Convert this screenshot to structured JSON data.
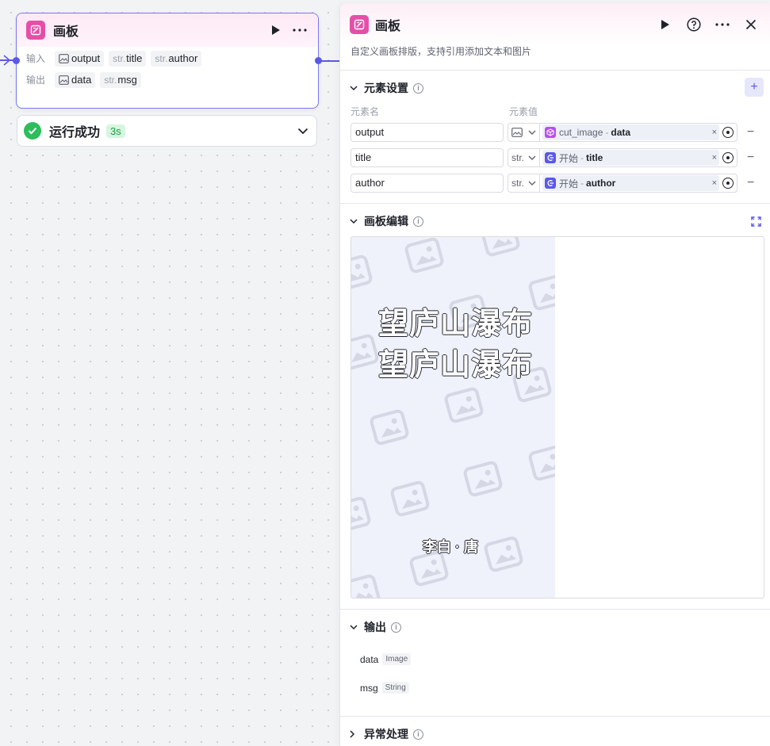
{
  "node": {
    "title": "画板",
    "input_label": "输入",
    "output_label": "输出",
    "inputs": [
      {
        "prefix": "",
        "name": "output",
        "icon": "image-icon"
      },
      {
        "prefix": "str.",
        "name": "title"
      },
      {
        "prefix": "str.",
        "name": "author"
      }
    ],
    "outputs": [
      {
        "prefix": "",
        "name": "data",
        "icon": "image-icon"
      },
      {
        "prefix": "str.",
        "name": "msg"
      }
    ]
  },
  "run_status": {
    "text": "运行成功",
    "time": "3s"
  },
  "panel": {
    "title": "画板",
    "description": "自定义画板排版，支持引用添加文本和图片",
    "elements_section": {
      "title": "元素设置",
      "col_name": "元素名",
      "col_value": "元素值",
      "rows": [
        {
          "name": "output",
          "type": "",
          "source": "cut_image",
          "sep": "-",
          "field": "data",
          "source_icon": "cube-icon"
        },
        {
          "name": "title",
          "type": "str.",
          "source": "开始",
          "sep": "-",
          "field": "title",
          "source_icon": "start-icon"
        },
        {
          "name": "author",
          "type": "str.",
          "source": "开始",
          "sep": "-",
          "field": "author",
          "source_icon": "start-icon"
        }
      ]
    },
    "canvas_section": {
      "title": "画板编辑",
      "poster_title_line1": "望庐山瀑布",
      "poster_title_line2": "望庐山瀑布",
      "poster_author": "李白 · 唐"
    },
    "output_section": {
      "title": "输出",
      "items": [
        {
          "name": "data",
          "type": "Image"
        },
        {
          "name": "msg",
          "type": "String"
        }
      ]
    },
    "error_section": {
      "title": "异常处理"
    }
  },
  "colors": {
    "accent": "#5a58e8",
    "brand_pink": "#e64fa8",
    "success": "#2ebd5c"
  }
}
